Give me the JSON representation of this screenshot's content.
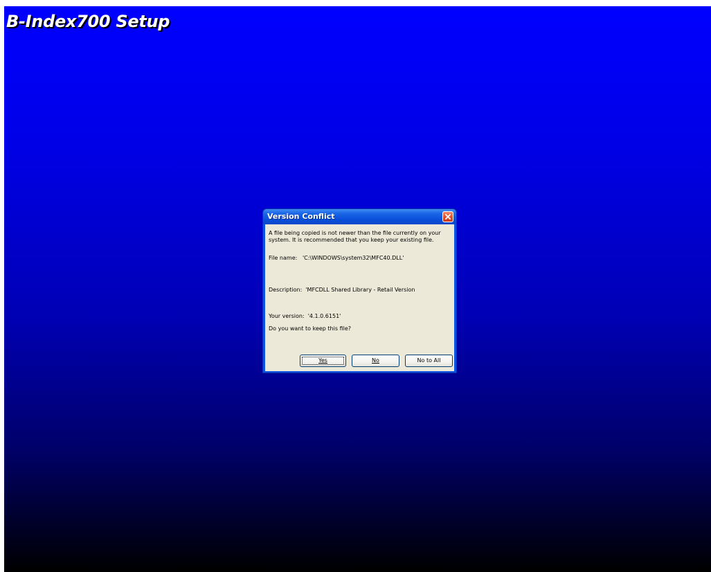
{
  "app": {
    "title": "B-Index700 Setup"
  },
  "dialog": {
    "title": "Version Conflict",
    "message_line1": "A file being copied is not newer than the file currently on your",
    "message_line2": "system. It is recommended that you keep your existing file.",
    "file_name": "File name:   'C:\\WINDOWS\\system32\\MFC40.DLL'",
    "description": "Description:  'MFCDLL Shared Library - Retail Version",
    "your_version": "Your version:  '4.1.0.6151'",
    "question": "Do you want to keep this file?",
    "buttons": {
      "yes": "Yes",
      "no": "No",
      "no_to_all": "No to All"
    }
  },
  "colors": {
    "desktop_top": "#0000ff",
    "desktop_bottom": "#000000",
    "titlebar": "#0a54e0",
    "dialog_face": "#ece9d8",
    "close_button": "#e2532f"
  },
  "icons": {
    "close": "close-icon"
  }
}
